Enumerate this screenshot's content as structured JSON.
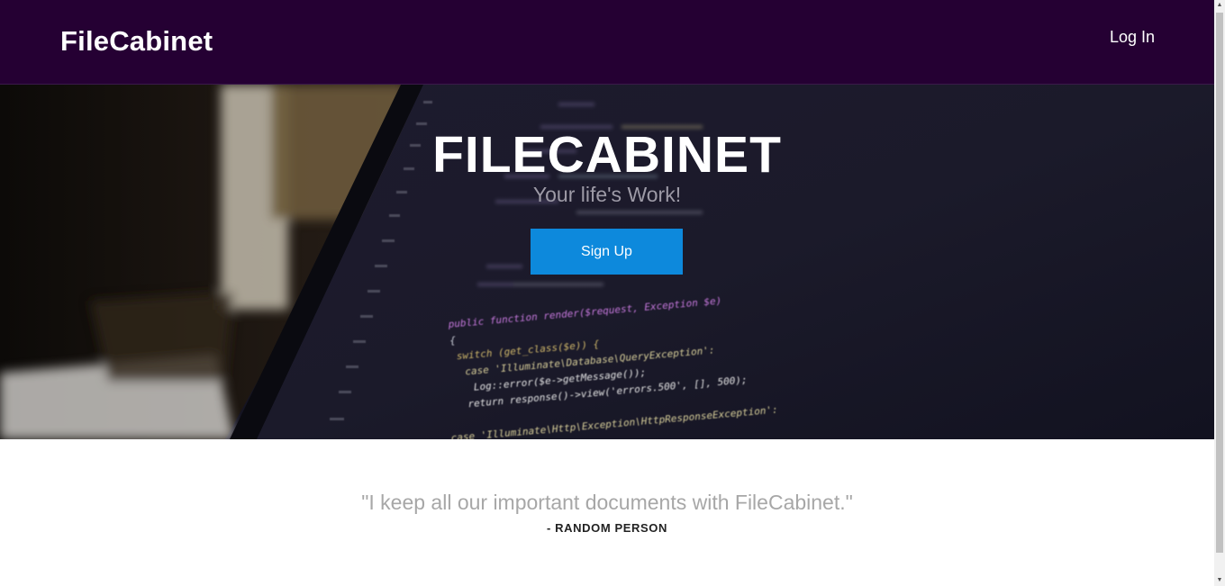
{
  "navbar": {
    "brand": "FileCabinet",
    "login_label": "Log In",
    "background": "#250033"
  },
  "hero": {
    "title": "FILECABINET",
    "subtitle": "Your life's Work!",
    "signup_label": "Sign Up",
    "button_color": "#0d89dc",
    "code_lines": [
      "public function render($request, Exception $e)",
      "{",
      "switch (get_class($e)) {",
      "case 'Illuminate\\Database\\QueryException':",
      "Log::error($e->getMessage());",
      "return response()->view('errors.500', [], 500);",
      "case 'Illuminate\\Http\\Exception\\HttpResponseException':"
    ]
  },
  "testimonial": {
    "quote": "\"I keep all our important documents with FileCabinet.\"",
    "author": "- RANDOM PERSON"
  },
  "scrollbar": {
    "up_icon": "chevron-up-icon",
    "down_icon": "chevron-down-icon"
  }
}
